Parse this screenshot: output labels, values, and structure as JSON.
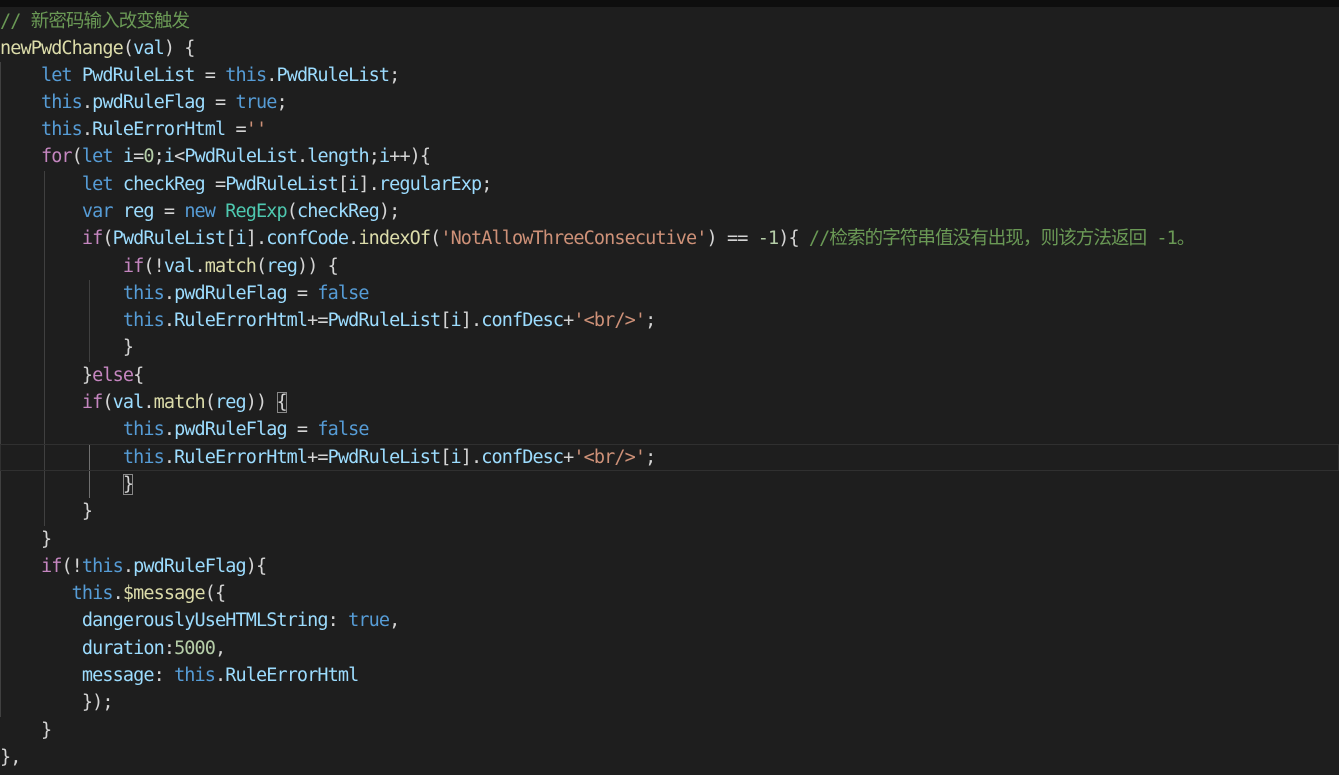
{
  "editor": {
    "language": "javascript",
    "theme_colors": {
      "background": "#1e1e1e",
      "keyword": "#569cd6",
      "control": "#c586c0",
      "function": "#dcdcaa",
      "variable": "#9cdcfe",
      "class": "#4ec9b0",
      "number": "#b5cea8",
      "string": "#ce9178",
      "comment": "#6a9955",
      "text": "#d4d4d4"
    },
    "lines": [
      [
        [
          "cmt",
          "// 新密码输入改变触发"
        ]
      ],
      [
        [
          "fn",
          "newPwdChange"
        ],
        [
          "pun",
          "("
        ],
        [
          "var",
          "val"
        ],
        [
          "pun",
          ") {"
        ]
      ],
      [
        [
          "pun",
          "    "
        ],
        [
          "kw",
          "let"
        ],
        [
          "pun",
          " "
        ],
        [
          "var",
          "PwdRuleList"
        ],
        [
          "pun",
          " = "
        ],
        [
          "kw",
          "this"
        ],
        [
          "pun",
          "."
        ],
        [
          "var",
          "PwdRuleList"
        ],
        [
          "pun",
          ";"
        ]
      ],
      [
        [
          "pun",
          "    "
        ],
        [
          "kw",
          "this"
        ],
        [
          "pun",
          "."
        ],
        [
          "var",
          "pwdRuleFlag"
        ],
        [
          "pun",
          " = "
        ],
        [
          "kw",
          "true"
        ],
        [
          "pun",
          ";"
        ]
      ],
      [
        [
          "pun",
          "    "
        ],
        [
          "kw",
          "this"
        ],
        [
          "pun",
          "."
        ],
        [
          "var",
          "RuleErrorHtml"
        ],
        [
          "pun",
          " ="
        ],
        [
          "str",
          "''"
        ]
      ],
      [
        [
          "pun",
          "    "
        ],
        [
          "ctl",
          "for"
        ],
        [
          "pun",
          "("
        ],
        [
          "kw",
          "let"
        ],
        [
          "pun",
          " "
        ],
        [
          "var",
          "i"
        ],
        [
          "pun",
          "="
        ],
        [
          "num",
          "0"
        ],
        [
          "pun",
          ";"
        ],
        [
          "var",
          "i"
        ],
        [
          "pun",
          "<"
        ],
        [
          "var",
          "PwdRuleList"
        ],
        [
          "pun",
          "."
        ],
        [
          "var",
          "length"
        ],
        [
          "pun",
          ";"
        ],
        [
          "var",
          "i"
        ],
        [
          "pun",
          "++){"
        ]
      ],
      [
        [
          "pun",
          "        "
        ],
        [
          "kw",
          "let"
        ],
        [
          "pun",
          " "
        ],
        [
          "var",
          "checkReg"
        ],
        [
          "pun",
          " ="
        ],
        [
          "var",
          "PwdRuleList"
        ],
        [
          "pun",
          "["
        ],
        [
          "var",
          "i"
        ],
        [
          "pun",
          "]."
        ],
        [
          "var",
          "regularExp"
        ],
        [
          "pun",
          ";"
        ]
      ],
      [
        [
          "pun",
          "        "
        ],
        [
          "kw",
          "var"
        ],
        [
          "pun",
          " "
        ],
        [
          "var",
          "reg"
        ],
        [
          "pun",
          " = "
        ],
        [
          "kw",
          "new"
        ],
        [
          "pun",
          " "
        ],
        [
          "cls",
          "RegExp"
        ],
        [
          "pun",
          "("
        ],
        [
          "var",
          "checkReg"
        ],
        [
          "pun",
          ");"
        ]
      ],
      [
        [
          "pun",
          "        "
        ],
        [
          "ctl",
          "if"
        ],
        [
          "pun",
          "("
        ],
        [
          "var",
          "PwdRuleList"
        ],
        [
          "pun",
          "["
        ],
        [
          "var",
          "i"
        ],
        [
          "pun",
          "]."
        ],
        [
          "var",
          "confCode"
        ],
        [
          "pun",
          "."
        ],
        [
          "fn",
          "indexOf"
        ],
        [
          "pun",
          "("
        ],
        [
          "str",
          "'NotAllowThreeConsecutive'"
        ],
        [
          "pun",
          ") == "
        ],
        [
          "num",
          "-1"
        ],
        [
          "pun",
          "){ "
        ],
        [
          "cmt",
          "//检索的字符串值没有出现，则该方法返回 -1。"
        ]
      ],
      [
        [
          "pun",
          "            "
        ],
        [
          "ctl",
          "if"
        ],
        [
          "pun",
          "(!"
        ],
        [
          "var",
          "val"
        ],
        [
          "pun",
          "."
        ],
        [
          "fn",
          "match"
        ],
        [
          "pun",
          "("
        ],
        [
          "var",
          "reg"
        ],
        [
          "pun",
          ")) {"
        ]
      ],
      [
        [
          "pun",
          "            "
        ],
        [
          "kw",
          "this"
        ],
        [
          "pun",
          "."
        ],
        [
          "var",
          "pwdRuleFlag"
        ],
        [
          "pun",
          " = "
        ],
        [
          "kw",
          "false"
        ]
      ],
      [
        [
          "pun",
          "            "
        ],
        [
          "kw",
          "this"
        ],
        [
          "pun",
          "."
        ],
        [
          "var",
          "RuleErrorHtml"
        ],
        [
          "pun",
          "+="
        ],
        [
          "var",
          "PwdRuleList"
        ],
        [
          "pun",
          "["
        ],
        [
          "var",
          "i"
        ],
        [
          "pun",
          "]."
        ],
        [
          "var",
          "confDesc"
        ],
        [
          "pun",
          "+"
        ],
        [
          "str",
          "'<br/>'"
        ],
        [
          "pun",
          ";"
        ]
      ],
      [
        [
          "pun",
          "            }"
        ]
      ],
      [
        [
          "pun",
          "        }"
        ],
        [
          "ctl",
          "else"
        ],
        [
          "pun",
          "{"
        ]
      ],
      [
        [
          "pun",
          "        "
        ],
        [
          "ctl",
          "if"
        ],
        [
          "pun",
          "("
        ],
        [
          "var",
          "val"
        ],
        [
          "pun",
          "."
        ],
        [
          "fn",
          "match"
        ],
        [
          "pun",
          "("
        ],
        [
          "var",
          "reg"
        ],
        [
          "pun",
          ")) "
        ],
        [
          "box",
          "{"
        ]
      ],
      [
        [
          "pun",
          "            "
        ],
        [
          "kw",
          "this"
        ],
        [
          "pun",
          "."
        ],
        [
          "var",
          "pwdRuleFlag"
        ],
        [
          "pun",
          " = "
        ],
        [
          "kw",
          "false"
        ]
      ],
      [
        [
          "pun",
          "            "
        ],
        [
          "kw",
          "this"
        ],
        [
          "pun",
          "."
        ],
        [
          "var",
          "RuleErrorHtml"
        ],
        [
          "pun",
          "+="
        ],
        [
          "var",
          "PwdRuleList"
        ],
        [
          "pun",
          "["
        ],
        [
          "var",
          "i"
        ],
        [
          "pun",
          "]."
        ],
        [
          "var",
          "confDesc"
        ],
        [
          "pun",
          "+"
        ],
        [
          "str",
          "'<br/>'"
        ],
        [
          "pun",
          ";"
        ]
      ],
      [
        [
          "pun",
          "            "
        ],
        [
          "box",
          "}"
        ]
      ],
      [
        [
          "pun",
          "        }"
        ]
      ],
      [
        [
          "pun",
          "    }"
        ]
      ],
      [
        [
          "pun",
          "    "
        ],
        [
          "ctl",
          "if"
        ],
        [
          "pun",
          "(!"
        ],
        [
          "kw",
          "this"
        ],
        [
          "pun",
          "."
        ],
        [
          "var",
          "pwdRuleFlag"
        ],
        [
          "pun",
          "){"
        ]
      ],
      [
        [
          "pun",
          "       "
        ],
        [
          "kw",
          "this"
        ],
        [
          "pun",
          "."
        ],
        [
          "fn",
          "$message"
        ],
        [
          "pun",
          "({"
        ]
      ],
      [
        [
          "pun",
          "        "
        ],
        [
          "var",
          "dangerouslyUseHTMLString"
        ],
        [
          "pun",
          ": "
        ],
        [
          "kw",
          "true"
        ],
        [
          "pun",
          ","
        ]
      ],
      [
        [
          "pun",
          "        "
        ],
        [
          "var",
          "duration"
        ],
        [
          "pun",
          ":"
        ],
        [
          "num",
          "5000"
        ],
        [
          "pun",
          ","
        ]
      ],
      [
        [
          "pun",
          "        "
        ],
        [
          "var",
          "message"
        ],
        [
          "pun",
          ": "
        ],
        [
          "kw",
          "this"
        ],
        [
          "pun",
          "."
        ],
        [
          "var",
          "RuleErrorHtml"
        ]
      ],
      [
        [
          "pun",
          "        });"
        ]
      ],
      [
        [
          "pun",
          "    }"
        ]
      ],
      [
        [
          "pun",
          "},"
        ]
      ]
    ]
  }
}
